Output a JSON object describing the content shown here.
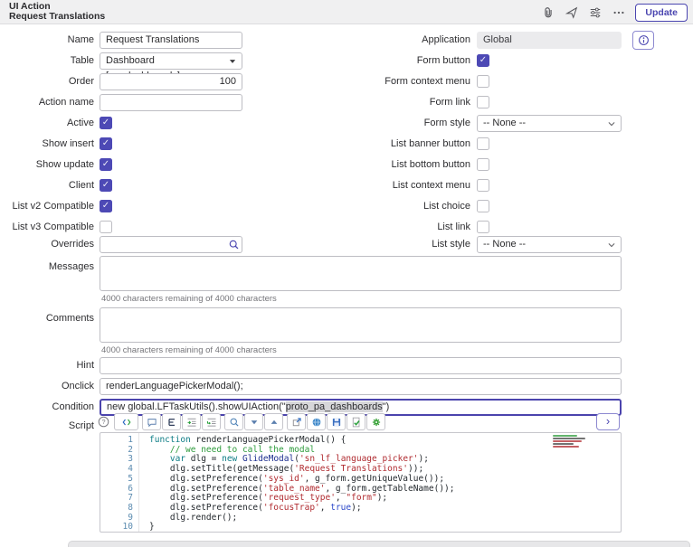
{
  "header": {
    "record_type": "UI Action",
    "record_title": "Request Translations",
    "toolbar_icons": [
      "paperclip-icon",
      "activity-stream-icon",
      "sliders-icon",
      "more-options-icon"
    ],
    "update_button": "Update"
  },
  "colors": {
    "accent": "#4a45b0",
    "checkbox_checked": "#4d49b5",
    "header_bg": "#f0f0f1",
    "readonly_bg": "#ebebed",
    "focus_border": "#4b44ad"
  },
  "fields": {
    "left_rows": [
      {
        "kind": "input",
        "label": "Name",
        "value": "Request Translations"
      },
      {
        "kind": "select",
        "label": "Table",
        "value": "Dashboard [pa_dashboards]",
        "caret": "triangle"
      },
      {
        "kind": "input",
        "label": "Order",
        "value": "100",
        "align": "right"
      },
      {
        "kind": "input",
        "label": "Action name",
        "value": ""
      },
      {
        "kind": "checkbox",
        "label": "Active",
        "checked": true
      },
      {
        "kind": "checkbox",
        "label": "Show insert",
        "checked": true
      },
      {
        "kind": "checkbox",
        "label": "Show update",
        "checked": true
      },
      {
        "kind": "checkbox",
        "label": "Client",
        "checked": true
      },
      {
        "kind": "checkbox",
        "label": "List v2 Compatible",
        "checked": true
      },
      {
        "kind": "checkbox",
        "label": "List v3 Compatible",
        "checked": false
      },
      {
        "kind": "reference",
        "label": "Overrides",
        "value": ""
      }
    ],
    "right_rows": [
      {
        "kind": "readonly",
        "label": "Application",
        "value": "Global",
        "info_button": true
      },
      {
        "kind": "checkbox",
        "label": "Form button",
        "checked": true
      },
      {
        "kind": "checkbox",
        "label": "Form context menu",
        "checked": false
      },
      {
        "kind": "checkbox",
        "label": "Form link",
        "checked": false
      },
      {
        "kind": "select",
        "label": "Form style",
        "value": "-- None --",
        "caret": "chevron"
      },
      {
        "kind": "checkbox",
        "label": "List banner button",
        "checked": false
      },
      {
        "kind": "checkbox",
        "label": "List bottom button",
        "checked": false
      },
      {
        "kind": "checkbox",
        "label": "List context menu",
        "checked": false
      },
      {
        "kind": "checkbox",
        "label": "List choice",
        "checked": false
      },
      {
        "kind": "checkbox",
        "label": "List link",
        "checked": false
      },
      {
        "kind": "select",
        "label": "List style",
        "value": "-- None --",
        "caret": "chevron"
      }
    ],
    "textarea_rows": [
      {
        "label": "Messages",
        "value": "",
        "counter": "4000 characters remaining of 4000 characters"
      },
      {
        "label": "Comments",
        "value": "",
        "counter": "4000 characters remaining of 4000 characters"
      }
    ],
    "wide_rows": [
      {
        "label": "Hint",
        "value": ""
      },
      {
        "label": "Onclick",
        "value": "renderLanguagePickerModal();"
      },
      {
        "label": "Condition",
        "value_pre": "new global.LFTaskUtils().showUIAction(\"",
        "value_selected": "proto_pa_dashboards",
        "value_post": "\")",
        "focused": true
      }
    ]
  },
  "script": {
    "label": "Script",
    "toolbar": [
      {
        "type": "plain",
        "icons": [
          "help-circle-icon"
        ]
      },
      {
        "type": "group",
        "icons": [
          "format-code-icon"
        ]
      },
      {
        "type": "group",
        "icons": [
          "comment-icon",
          "format-align-icon",
          "indent-right-icon",
          "indent-block-icon"
        ]
      },
      {
        "type": "group",
        "icons": [
          "search-icon",
          "chevron-down-icon",
          "chevron-up-icon"
        ]
      },
      {
        "type": "group",
        "icons": [
          "pop-out-icon",
          "api-docs-icon",
          "save-icon",
          "syntax-check-icon",
          "macro-icon"
        ]
      }
    ],
    "expand_button": "›",
    "code_lines": [
      {
        "indent": 0,
        "tokens": [
          [
            "kw",
            "function"
          ],
          [
            "pl",
            " renderLanguagePickerModal() {"
          ]
        ]
      },
      {
        "indent": 1,
        "tokens": [
          [
            "com",
            "// we need to call the modal"
          ]
        ]
      },
      {
        "indent": 1,
        "tokens": [
          [
            "kw",
            "var"
          ],
          [
            "pl",
            " dlg = "
          ],
          [
            "kw",
            "new"
          ],
          [
            "pl",
            " "
          ],
          [
            "cls",
            "GlideModal"
          ],
          [
            "pl",
            "("
          ],
          [
            "str",
            "'sn_lf_language_picker'"
          ],
          [
            "pl",
            ");"
          ]
        ]
      },
      {
        "indent": 1,
        "tokens": [
          [
            "pl",
            "dlg.setTitle(getMessage("
          ],
          [
            "str",
            "'Request Translations'"
          ],
          [
            "pl",
            "));"
          ]
        ]
      },
      {
        "indent": 1,
        "tokens": [
          [
            "pl",
            "dlg.setPreference("
          ],
          [
            "str",
            "'sys_id'"
          ],
          [
            "pl",
            ", g_form.getUniqueValue());"
          ]
        ]
      },
      {
        "indent": 1,
        "tokens": [
          [
            "pl",
            "dlg.setPreference("
          ],
          [
            "str",
            "'table_name'"
          ],
          [
            "pl",
            ", g_form.getTableName());"
          ]
        ]
      },
      {
        "indent": 1,
        "tokens": [
          [
            "pl",
            "dlg.setPreference("
          ],
          [
            "str",
            "'request_type'"
          ],
          [
            "pl",
            ", "
          ],
          [
            "str",
            "\"form\""
          ],
          [
            "pl",
            ");"
          ]
        ]
      },
      {
        "indent": 1,
        "tokens": [
          [
            "pl",
            "dlg.setPreference("
          ],
          [
            "str",
            "'focusTrap'"
          ],
          [
            "pl",
            ", "
          ],
          [
            "atom",
            "true"
          ],
          [
            "pl",
            ");"
          ]
        ]
      },
      {
        "indent": 1,
        "tokens": [
          [
            "pl",
            "dlg.render();"
          ]
        ]
      },
      {
        "indent": 0,
        "tokens": [
          [
            "pl",
            "}"
          ]
        ]
      }
    ]
  }
}
